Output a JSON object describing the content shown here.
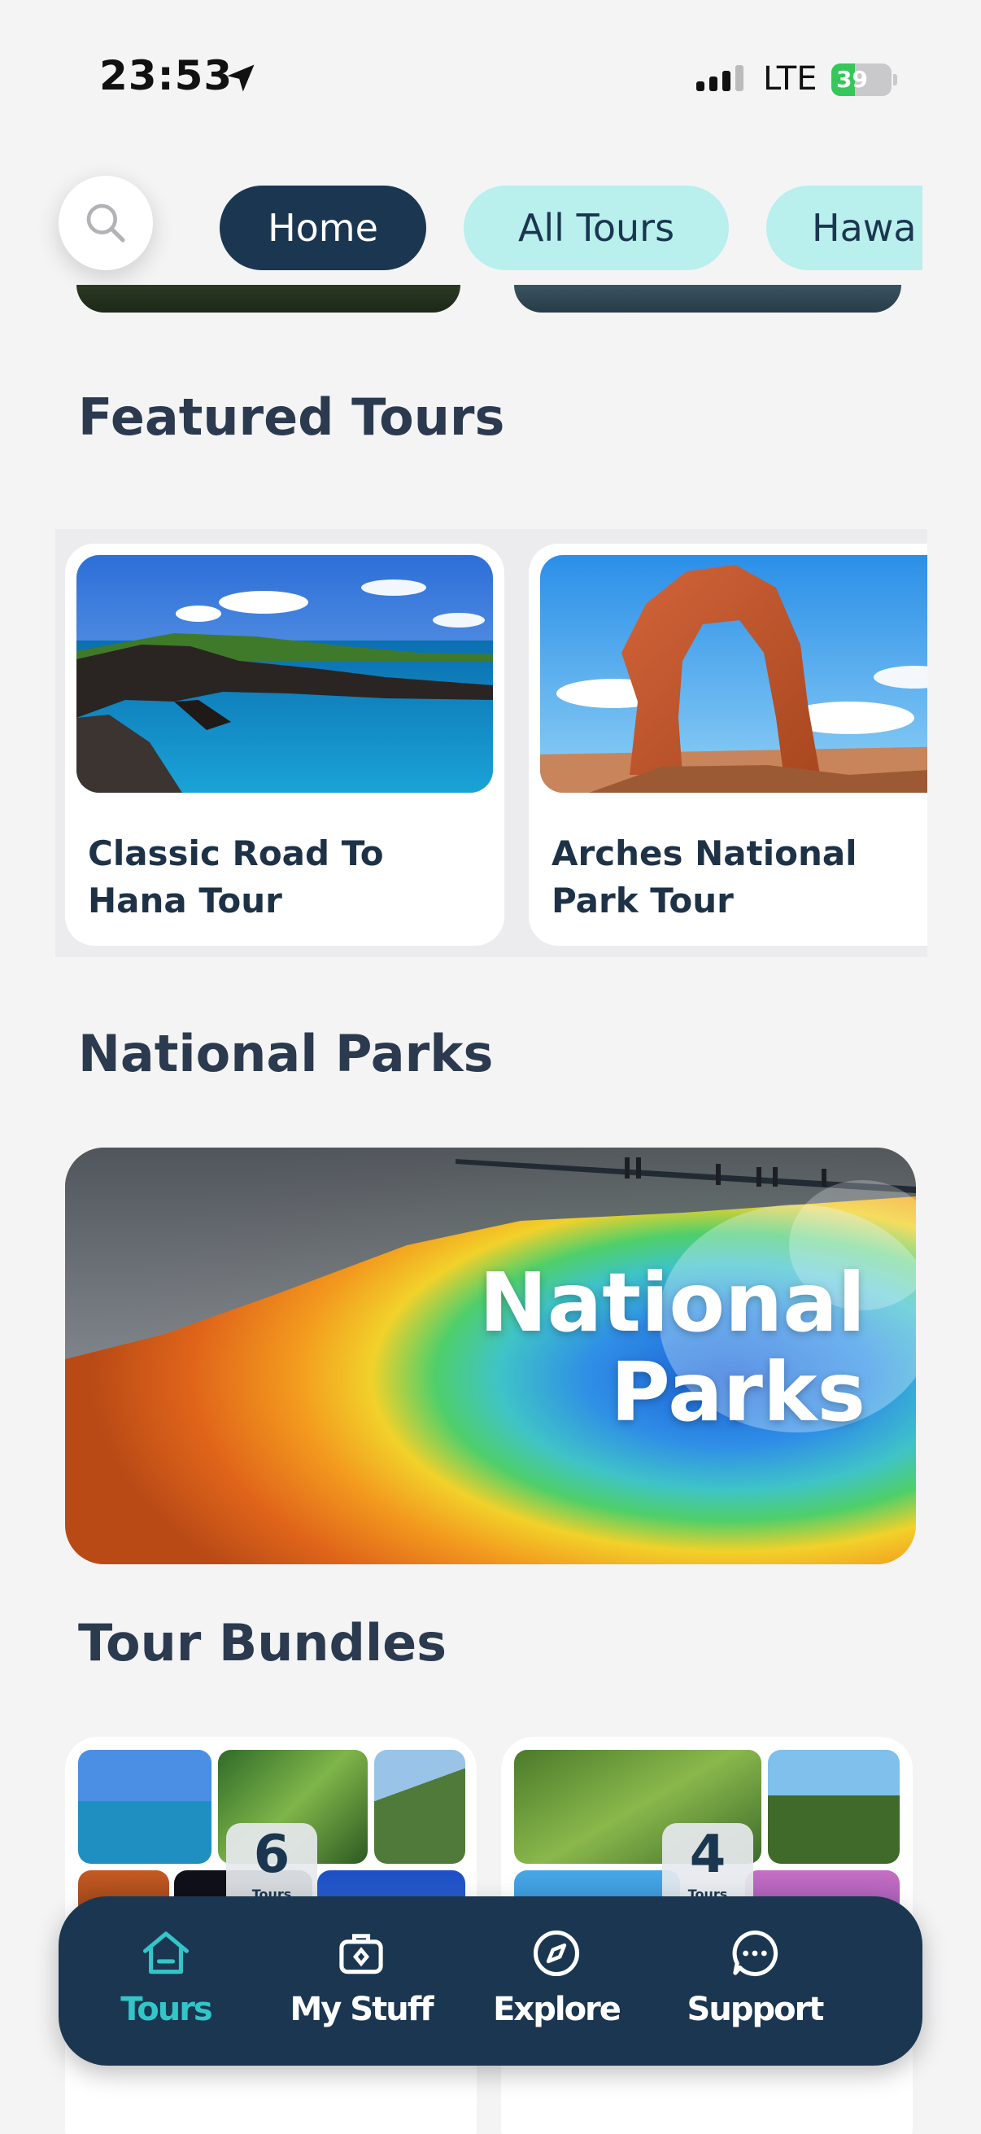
{
  "status_bar": {
    "time": "23:53",
    "network": "LTE",
    "battery_percent": "39"
  },
  "top_nav": {
    "search_icon": "search-icon",
    "chips": [
      {
        "label": "Home",
        "active": true
      },
      {
        "label": "All Tours",
        "active": false
      },
      {
        "label": "Hawa",
        "active": false
      }
    ]
  },
  "featured": {
    "title": "Featured Tours",
    "cards": [
      {
        "line1": "Classic Road To",
        "line2": "Hana Tour"
      },
      {
        "line1": "Arches National",
        "line2": "Park Tour"
      }
    ]
  },
  "national_parks": {
    "title": "National Parks",
    "banner_line1": "National",
    "banner_line2": "Parks"
  },
  "bundles": {
    "title": "Tour Bundles",
    "cards": [
      {
        "count": "6",
        "count_label": "Tours"
      },
      {
        "count": "4",
        "count_label": "Tours"
      }
    ]
  },
  "bottom_nav": {
    "items": [
      {
        "label": "Tours",
        "icon": "home-icon",
        "active": true
      },
      {
        "label": "My Stuff",
        "icon": "bag-icon",
        "active": false
      },
      {
        "label": "Explore",
        "icon": "compass-icon",
        "active": false
      },
      {
        "label": "Support",
        "icon": "chat-icon",
        "active": false
      }
    ]
  },
  "colors": {
    "navy": "#1b3650",
    "teal": "#33c6c9",
    "chip_inactive": "#b9efec",
    "text": "#2b3a4e"
  }
}
